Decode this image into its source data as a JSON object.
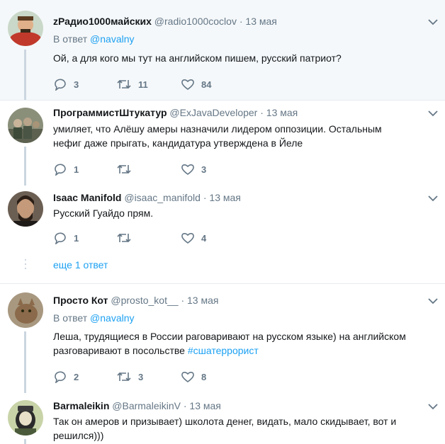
{
  "tweets": [
    {
      "name": "zРадио1000майских",
      "handle": "@radio1000coclov",
      "dot": "·",
      "date": "13 мая",
      "reply_prefix": "В ответ",
      "reply_mention": "@navalny",
      "text": "Ой, а для кого мы тут на английском пишем, русский патриот?",
      "replies": "3",
      "retweets": "11",
      "likes": "84"
    },
    {
      "name": "ПрограммистШтукатур",
      "handle": "@ExJavaDeveloper",
      "dot": "·",
      "date": "13 мая",
      "text_line1": "умиляет, что Алёшу амеры назначили лидером оппозиции. Остальным",
      "text_line2": "нефиг даже прыгать, кандидатура утверждена в Йеле",
      "replies": "1",
      "retweets": "",
      "likes": "3"
    },
    {
      "name": "Isaac Manifold",
      "handle": "@isaac_manifold",
      "dot": "·",
      "date": "13 мая",
      "text": "Русский Гуайдо прям.",
      "replies": "1",
      "retweets": "",
      "likes": "4"
    },
    {
      "name": "Просто Кот",
      "handle": "@prosto_kot__",
      "dot": "·",
      "date": "13 мая",
      "reply_prefix": "В ответ",
      "reply_mention": "@navalny",
      "text_line1": "Леша, трудящиеся в России раговаривают на русском языке) на английском",
      "text_line2": "разговаривают в посольстве",
      "hashtag": "#сшатеррорист",
      "replies": "2",
      "retweets": "3",
      "likes": "8"
    },
    {
      "name": "Barmaleikin",
      "handle": "@BarmaleikinV",
      "dot": "·",
      "date": "13 мая",
      "text_line1": "Так он амеров и призывает) школота денег, видать, мало скидывает, вот и",
      "text_line2": "решился)))"
    }
  ],
  "more_replies": "еще 1 ответ",
  "colors": {
    "accent": "#1da1f2",
    "muted": "#657786",
    "highlight_bg": "#f5f8fa"
  },
  "icons": [
    "reply-icon",
    "retweet-icon",
    "like-icon",
    "chevron-down-icon"
  ]
}
